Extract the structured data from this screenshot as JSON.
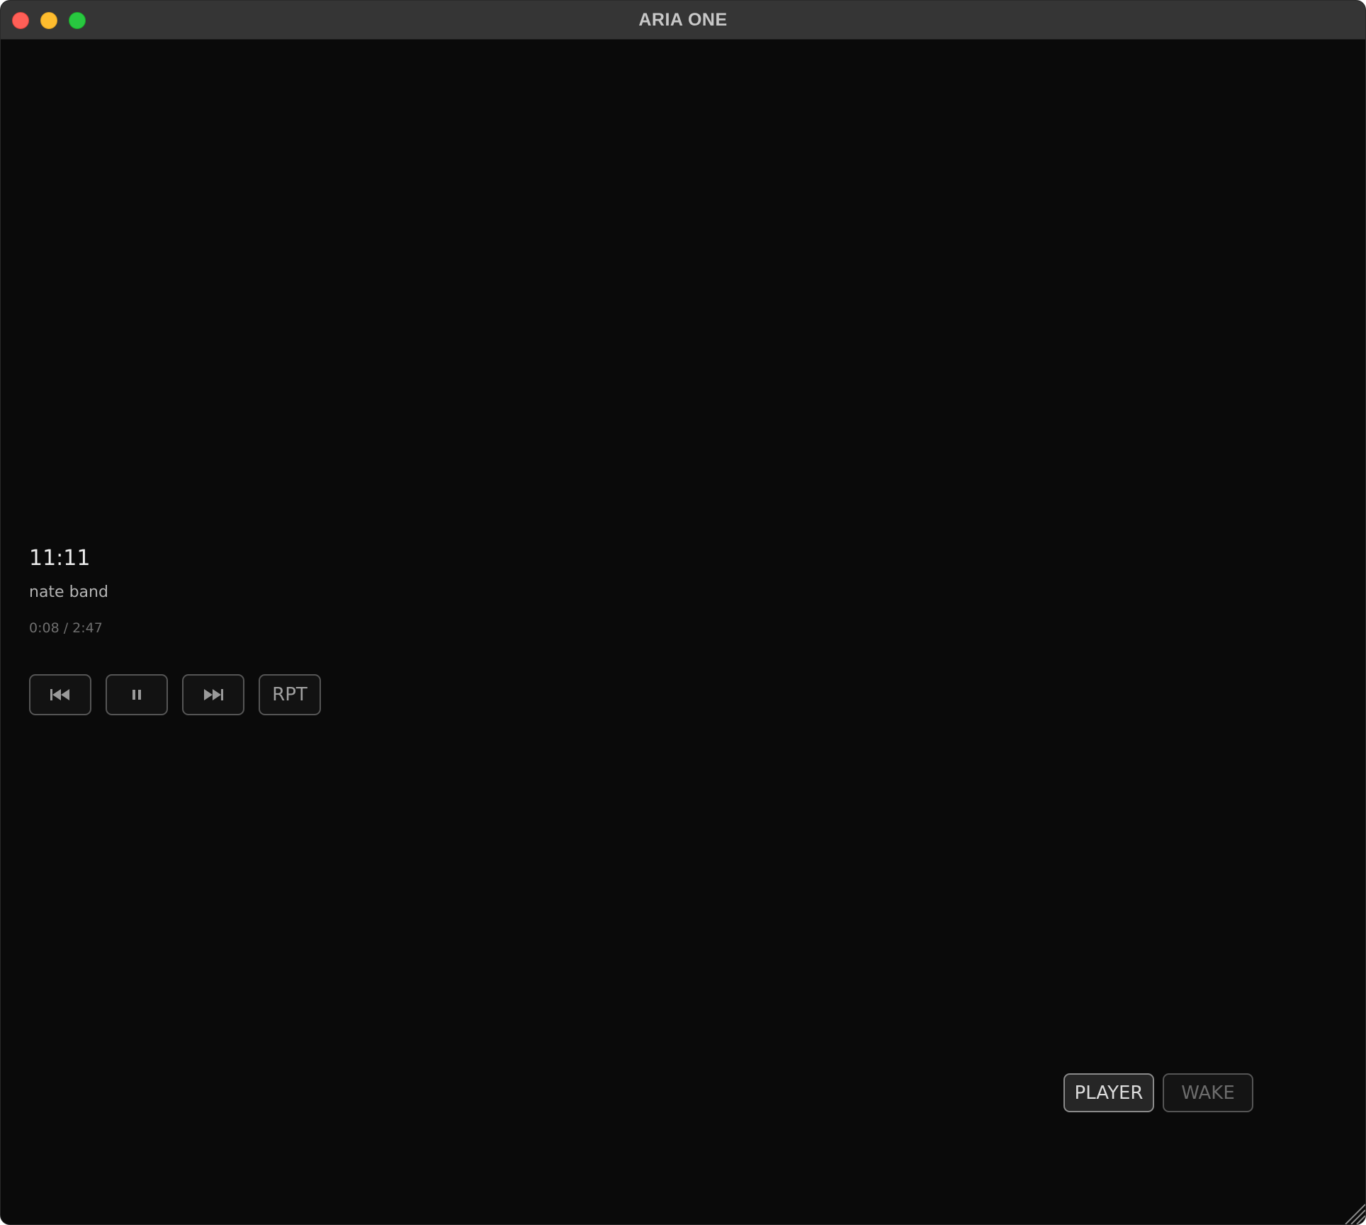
{
  "window": {
    "title": "ARIA ONE"
  },
  "track": {
    "title": "11:11",
    "artist": "nate band",
    "time": "0:08 / 2:47"
  },
  "controls": {
    "previous_icon": "skip-previous-icon",
    "pause_icon": "pause-icon",
    "next_icon": "skip-next-icon",
    "repeat_label": "RPT"
  },
  "modes": {
    "player_label": "PLAYER",
    "wake_label": "WAKE",
    "active": "PLAYER"
  },
  "colors": {
    "background": "#0a0a0a",
    "titlebar": "#353535",
    "close": "#ff5f57",
    "minimize": "#febc2e",
    "zoom": "#28c840"
  }
}
